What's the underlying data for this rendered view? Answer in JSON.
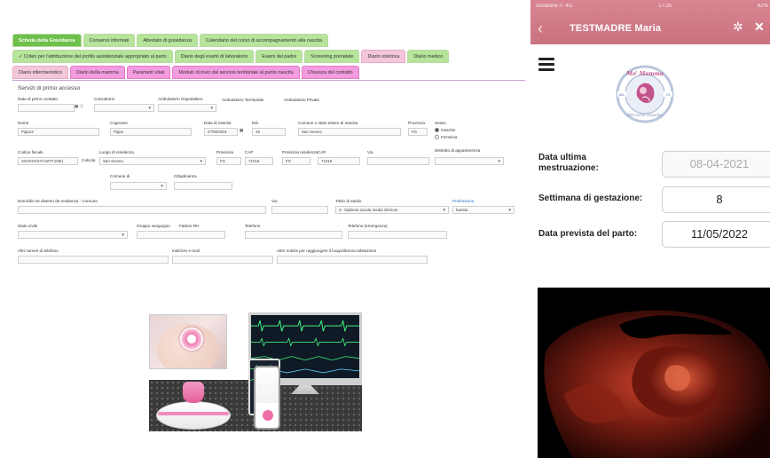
{
  "form": {
    "tabs_row1": [
      "Scheda della Gravidanza",
      "Consensi informati",
      "Attestato di gravidanza",
      "Calendario del corso di accompagnamento alla nascita"
    ],
    "tabs_row2": [
      "✓ Criteri per l'attribuzione del profilo assistenziale appropriato al parto",
      "Diario degli esami di laboratorio",
      "Esami del padre",
      "Screening prenatale",
      "Diario ostetrica",
      "Diario medico"
    ],
    "tabs_row3": [
      "Diario infermieristico",
      "Diario della mamma",
      "Parametri vitali",
      "Modulo di invio dal servizio territoriale al punto nascita",
      "Chiusura del contatto"
    ],
    "section_title": "Servizi di primo accesso",
    "labels": {
      "first_contact": "Data di primo contatto",
      "consultorio": "Consultorio",
      "amb_osp": "Ambulatorio Ospedaliero",
      "amb_terr": "Ambulatorio Territoriale",
      "amb_priv": "Ambulatorio Privato",
      "nome": "Nome",
      "cognome": "Cognome",
      "data_nascita": "Data di nascita",
      "eta": "Età",
      "comune_nascita": "Comune o stato estero di nascita",
      "provincia": "Provincia",
      "sesso": "Sesso",
      "codice_fiscale": "Codice fiscale",
      "luogo_residenza": "Luogo di residenza",
      "provincia2": "Provincia",
      "cap": "CAP",
      "prov_residenza": "Provincia residenza",
      "cap2": "CAP",
      "via": "Via",
      "distretto": "Distretto di appartenenza",
      "comune_di": "Comune di",
      "cittadinanza": "Cittadinanza",
      "domicilio": "Domicilio se diverso da residenza - Comune",
      "via2": "Via",
      "titolo_studio": "Titolo di studio",
      "professione": "Professione",
      "stato_civile": "Stato civile",
      "gruppo_sanguigno": "Gruppo sanguigno",
      "fattore_rh": "Fattore RH",
      "telefono": "Telefono",
      "telefono_emergenza": "Telefono (emergenza)",
      "altri_numeri": "Altri numeri di telefono",
      "email": "Indirizzo e-mail",
      "altre_notizie": "Altre notizie per raggiungere il luogo/dimora /abitazione"
    },
    "values": {
      "nome": "Pippo2",
      "cognome": "Pippo",
      "data_nascita": "27/06/2001",
      "eta": "19",
      "comune_nascita": "San Severo",
      "provincia": "FG",
      "sesso_maschio": "maschio",
      "sesso_femmina": "Femmina",
      "codice_fiscale": "XXXXXXXYY4Z7Y100U",
      "calcola": "Calcola",
      "luogo_residenza": "San Severo",
      "provincia2": "FG",
      "cap": "71016",
      "prov_residenza": "FG",
      "cap2": "71016",
      "titolo_studio": "3 - Diploma scuola media inferiore",
      "professione": "barista"
    }
  },
  "app": {
    "status_carrier": "vodafone IT  4G",
    "status_time": "17:25",
    "status_battery": "62%",
    "title": "TESTMADRE Maria",
    "logo_top": "Mo' Mamma",
    "logo_bottom": "Percorso Nascita",
    "logo_left": "ASL",
    "logo_right": "FG",
    "rows": [
      {
        "label": "Data ultima mestruazione:",
        "value": "08-04-2021"
      },
      {
        "label": "Settimana di gestazione:",
        "value": "8"
      },
      {
        "label": "Data prevista del parto:",
        "value": "11/05/2022"
      }
    ]
  },
  "icons": {
    "menu": "hamburger-icon",
    "back": "chevron-left-icon",
    "settings": "gear-icon",
    "close": "close-icon"
  }
}
